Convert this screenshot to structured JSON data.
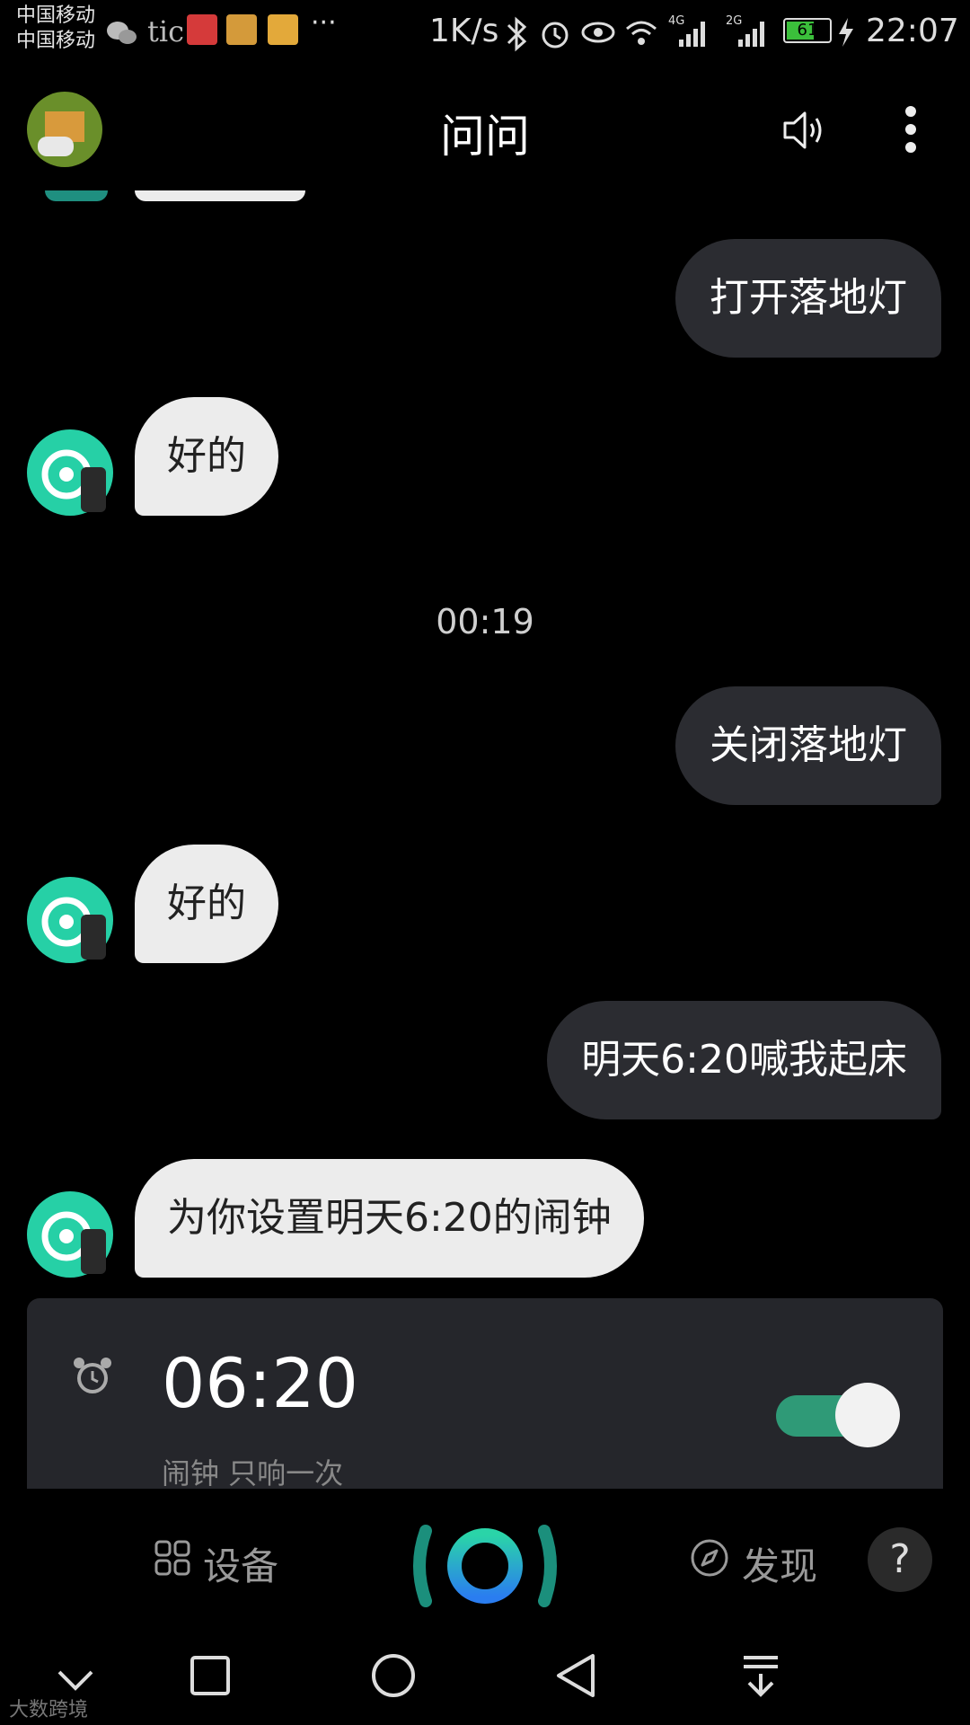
{
  "status_bar": {
    "carrier1": "中国移动",
    "carrier2": "中国移动",
    "app_text": "tic",
    "more": "···",
    "speed": "1K/s",
    "net1": "4G",
    "net2": "2G",
    "battery": "61",
    "time": "22:07"
  },
  "header": {
    "title": "问问"
  },
  "messages": [
    {
      "from": "user",
      "text": "打开落地灯"
    },
    {
      "from": "bot",
      "text": "好的"
    },
    {
      "from": "user",
      "text": "关闭落地灯"
    },
    {
      "from": "bot",
      "text": "好的"
    },
    {
      "from": "user",
      "text": "明天6:20喊我起床"
    },
    {
      "from": "bot",
      "text": "为你设置明天6:20的闹钟"
    }
  ],
  "timestamp": "00:19",
  "alarm": {
    "time": "06:20",
    "description": "闹钟 只响一次",
    "enabled": true
  },
  "tabs": {
    "devices": "设备",
    "discover": "发现",
    "help": "?"
  },
  "watermark": "大数跨境",
  "colors": {
    "bubble_user": "#2b2c31",
    "bubble_bot": "#ececec",
    "toggle_on": "#2f9a77",
    "accent": "#23c4b0"
  }
}
